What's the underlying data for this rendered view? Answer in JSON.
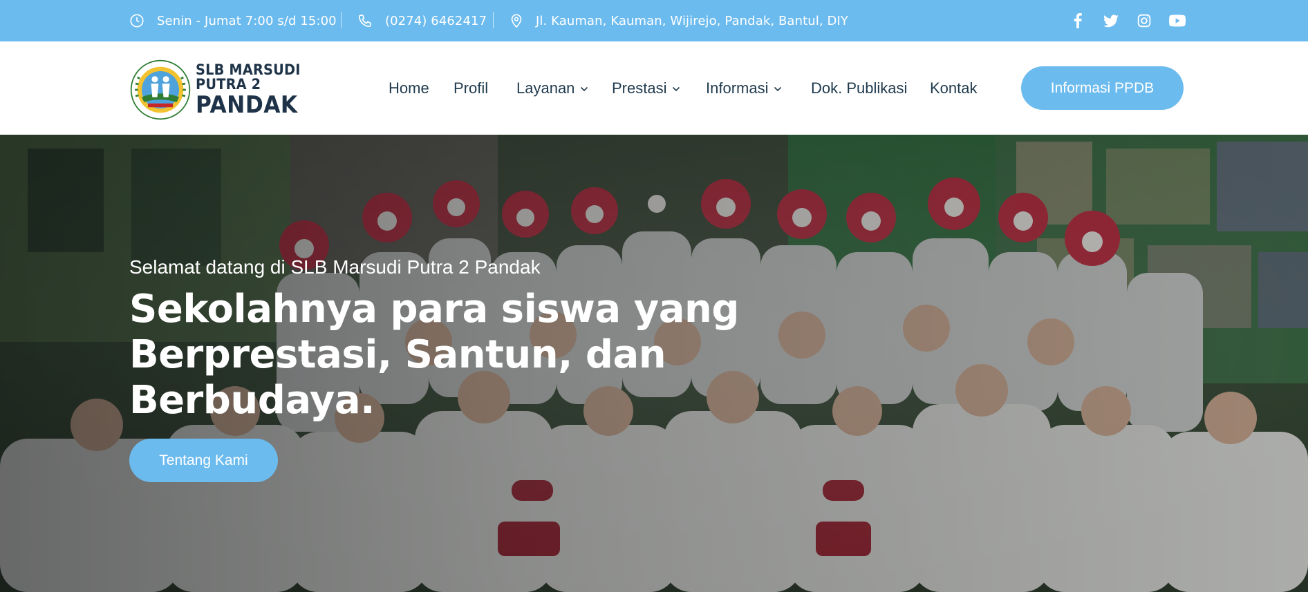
{
  "topbar": {
    "hours": "Senin - Jumat 7:00 s/d 15:00",
    "phone": "(0274) 6462417",
    "address": "Jl. Kauman, Kauman, Wijirejo, Pandak, Bantul, DIY",
    "socials": [
      "facebook-icon",
      "twitter-icon",
      "instagram-icon",
      "youtube-icon"
    ],
    "background_color": "#6cbbef"
  },
  "header": {
    "logo": {
      "line1": "SLB MARSUDI PUTRA 2",
      "line2": "PANDAK",
      "emblem_text": "SLB MARSUDI PUTRA II PANDAK BANTUL"
    },
    "nav": [
      {
        "label": "Home",
        "dropdown": false
      },
      {
        "label": "Profil",
        "dropdown": false
      },
      {
        "label": "Layanan",
        "dropdown": true
      },
      {
        "label": "Prestasi",
        "dropdown": true
      },
      {
        "label": "Informasi",
        "dropdown": true
      },
      {
        "label": "Dok. Publikasi",
        "dropdown": false
      },
      {
        "label": "Kontak",
        "dropdown": false
      }
    ],
    "cta_label": "Informasi PPDB"
  },
  "hero": {
    "subtitle": "Selamat datang di SLB Marsudi Putra 2 Pandak",
    "title_lines": [
      "Sekolahnya para siswa yang",
      "Berprestasi, Santun, dan",
      "Berbudaya."
    ],
    "button_label": "Tentang Kami"
  },
  "colors": {
    "accent": "#6cbbef",
    "nav_text": "#1f3a4d",
    "white": "#ffffff"
  }
}
